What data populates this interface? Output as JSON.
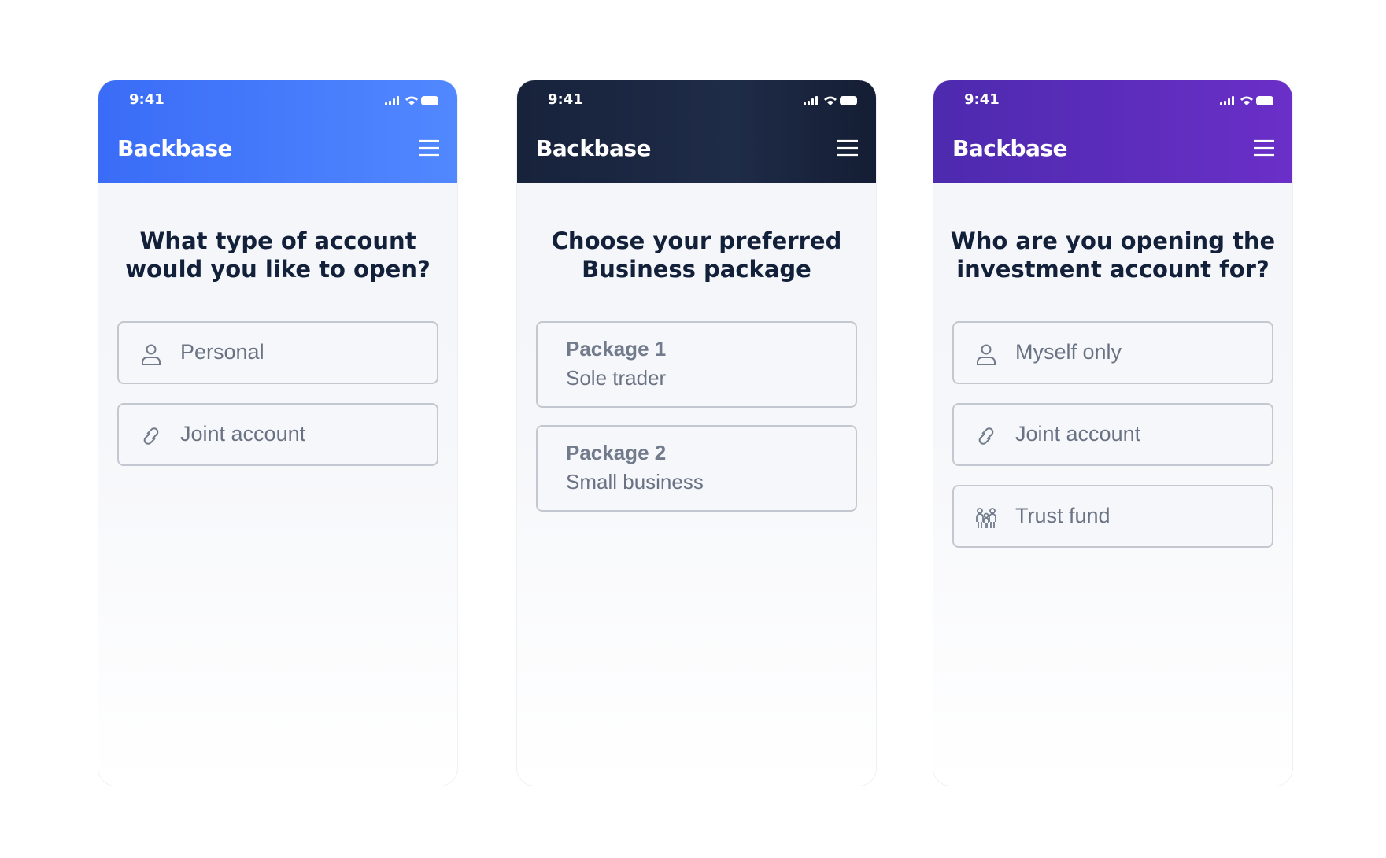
{
  "screens": [
    {
      "status_time": "9:41",
      "brand": "Backbase",
      "title": "What type of account would you like to open?",
      "options": [
        {
          "icon": "person-icon",
          "label": "Personal"
        },
        {
          "icon": "link-icon",
          "label": "Joint account"
        }
      ]
    },
    {
      "status_time": "9:41",
      "brand": "Backbase",
      "title": "Choose your preferred Business package",
      "options": [
        {
          "name": "Package 1",
          "subtitle": "Sole trader"
        },
        {
          "name": "Package 2",
          "subtitle": "Small business"
        }
      ]
    },
    {
      "status_time": "9:41",
      "brand": "Backbase",
      "title": "Who are you opening the investment account for?",
      "options": [
        {
          "icon": "person-icon",
          "label": "Myself only"
        },
        {
          "icon": "link-icon",
          "label": "Joint account"
        },
        {
          "icon": "family-icon",
          "label": "Trust fund"
        }
      ]
    }
  ],
  "colors": {
    "screen1_header": "#3a6cf7",
    "screen2_header": "#17223b",
    "screen3_header": "#5b2dbc",
    "title_text": "#13203a",
    "option_border": "#c3c8d0",
    "option_text": "#6a7384"
  }
}
